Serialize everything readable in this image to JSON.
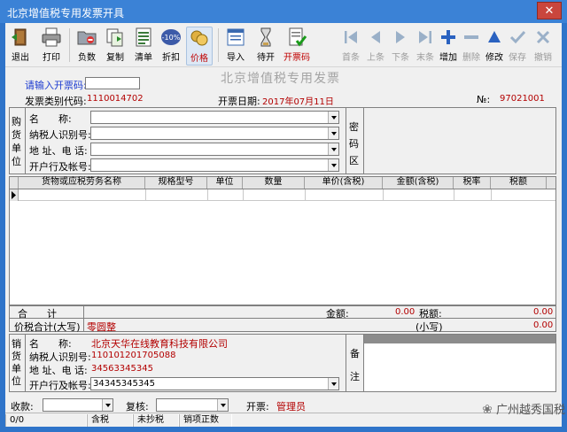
{
  "window": {
    "title": "北京增值税专用发票开具",
    "close_symbol": "✕"
  },
  "toolbar": {
    "left": [
      {
        "label": "退出",
        "icon": "exit-door-icon"
      },
      {
        "label": "打印",
        "icon": "printer-icon"
      },
      {
        "label": "负数",
        "icon": "folder-negative-icon"
      },
      {
        "label": "复制",
        "icon": "copy-icon"
      },
      {
        "label": "清单",
        "icon": "list-icon"
      },
      {
        "label": "折扣",
        "icon": "discount-icon",
        "badge": "-10%"
      },
      {
        "label": "价格",
        "icon": "price-coins-icon"
      }
    ],
    "middle": [
      {
        "label": "导入",
        "icon": "import-icon"
      },
      {
        "label": "待开",
        "icon": "pending-icon"
      },
      {
        "label": "开票码",
        "icon": "invoice-code-icon"
      }
    ],
    "right": [
      {
        "label": "首条",
        "icon": "first-record-icon"
      },
      {
        "label": "上条",
        "icon": "prev-record-icon"
      },
      {
        "label": "下条",
        "icon": "next-record-icon"
      },
      {
        "label": "末条",
        "icon": "last-record-icon"
      },
      {
        "label": "增加",
        "icon": "add-icon"
      },
      {
        "label": "删除",
        "icon": "delete-icon"
      },
      {
        "label": "修改",
        "icon": "edit-icon"
      },
      {
        "label": "保存",
        "icon": "save-check-icon"
      },
      {
        "label": "撤销",
        "icon": "undo-icon"
      }
    ]
  },
  "invoice": {
    "title": "北京增值税专用发票",
    "code_prompt": "请输入开票码:",
    "type_code_label": "发票类别代码:",
    "type_code": "1110014702",
    "date_label": "开票日期:",
    "date": "2017年07月11日",
    "number_label": "№:",
    "number": "97021001"
  },
  "buyer": {
    "section_label": "购货单位",
    "fields": [
      {
        "label": "名　　称:",
        "value": ""
      },
      {
        "label": "纳税人识别号:",
        "value": ""
      },
      {
        "label": "地 址、电 话:",
        "value": ""
      },
      {
        "label": "开户行及帐号:",
        "value": ""
      }
    ],
    "secret_label": "密码区"
  },
  "goods": {
    "columns": [
      "货物或应税劳务名称",
      "规格型号",
      "单位",
      "数量",
      "单价(含税)",
      "金额(含税)",
      "税率",
      "税额"
    ]
  },
  "totals": {
    "sum_label": "合　　计",
    "amount_label": "金额:",
    "amount": "0.00",
    "tax_label": "税额:",
    "tax": "0.00",
    "total_upper_label": "价税合计(大写)",
    "total_upper": "零圆整",
    "total_lower_label": "(小写)",
    "total_lower": "0.00"
  },
  "seller": {
    "section_label": "销货单位",
    "fields": [
      {
        "label": "名　　称:",
        "value": "北京天华在线教育科技有限公司"
      },
      {
        "label": "纳税人识别号:",
        "value": "110101201705088"
      },
      {
        "label": "地 址、电 话:",
        "value": "34563345345"
      },
      {
        "label": "开户行及帐号:",
        "value": "34345345345"
      }
    ],
    "remark_label": "备注"
  },
  "footer": {
    "receiver_label": "收款:",
    "reviewer_label": "复核:",
    "issuer_label": "开票:",
    "issuer": "管理员"
  },
  "statusbar": [
    "0/0",
    "含税",
    "未抄税",
    "销项正数"
  ],
  "watermark": "广州越秀国税",
  "colors": {
    "accent_red": "#b30000",
    "accent_blue": "#1d3cd0",
    "title_bar": "#3b82d6"
  }
}
